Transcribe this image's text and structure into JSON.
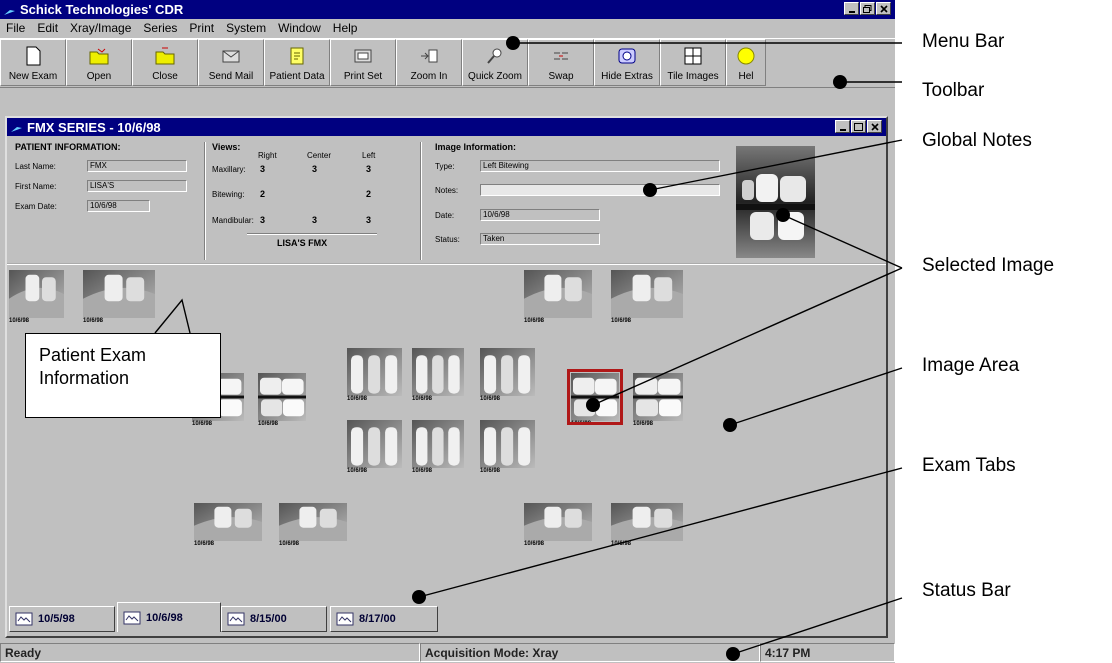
{
  "window": {
    "title": "Schick Technologies' CDR"
  },
  "menu": {
    "items": [
      "File",
      "Edit",
      "Xray/Image",
      "Series",
      "Print",
      "System",
      "Window",
      "Help"
    ]
  },
  "toolbar": {
    "buttons": [
      {
        "label": "New Exam",
        "icon": "new-document-icon"
      },
      {
        "label": "Open",
        "icon": "open-folder-icon"
      },
      {
        "label": "Close",
        "icon": "close-folder-icon"
      },
      {
        "label": "Send Mail",
        "icon": "mail-icon"
      },
      {
        "label": "Patient Data",
        "icon": "patient-data-icon"
      },
      {
        "label": "Print Set",
        "icon": "print-icon"
      },
      {
        "label": "Zoom In",
        "icon": "zoom-in-icon"
      },
      {
        "label": "Quick Zoom",
        "icon": "quick-zoom-icon"
      },
      {
        "label": "Swap",
        "icon": "swap-icon"
      },
      {
        "label": "Hide Extras",
        "icon": "hide-extras-icon"
      },
      {
        "label": "Tile Images",
        "icon": "tile-images-icon"
      },
      {
        "label": "Hel",
        "icon": "help-icon"
      }
    ]
  },
  "exam_window": {
    "title": "FMX SERIES - 10/6/98"
  },
  "patient_info": {
    "heading": "PATIENT INFORMATION:",
    "last_name_label": "Last Name:",
    "last_name": "FMX",
    "first_name_label": "First Name:",
    "first_name": "LISA'S",
    "exam_date_label": "Exam Date:",
    "exam_date": "10/6/98"
  },
  "views": {
    "heading": "Views:",
    "columns": [
      "Right",
      "Center",
      "Left"
    ],
    "rows": [
      {
        "label": "Maxillary:",
        "values": [
          "3",
          "3",
          "3"
        ]
      },
      {
        "label": "Bitewing:",
        "values": [
          "2",
          "",
          "2"
        ]
      },
      {
        "label": "Mandibular:",
        "values": [
          "3",
          "3",
          "3"
        ]
      }
    ],
    "exam_name": "LISA'S FMX"
  },
  "image_info": {
    "heading": "Image Information:",
    "type_label": "Type:",
    "type": "Left Bitewing",
    "notes_label": "Notes:",
    "notes": "",
    "date_label": "Date:",
    "date": "10/6/98",
    "status_label": "Status:",
    "status": "Taken"
  },
  "thumbnail_date": "10/6/98",
  "exam_tabs": [
    "10/5/98",
    "10/6/98",
    "8/15/00",
    "8/17/00"
  ],
  "selected_tab_index": 1,
  "status": {
    "left": "Ready",
    "mode": "Acquisition Mode: Xray",
    "time": "4:17 PM"
  },
  "annotations": {
    "menu_bar": "Menu Bar",
    "toolbar": "Toolbar",
    "global_notes": "Global Notes",
    "selected_image": "Selected Image",
    "image_area": "Image Area",
    "exam_tabs": "Exam Tabs",
    "status_bar": "Status Bar",
    "patient_exam_info_line1": "Patient Exam",
    "patient_exam_info_line2": "Information"
  },
  "colors": {
    "title_bar": "#000080",
    "window_face": "#c0c0c0",
    "selected_frame": "#b01818"
  }
}
